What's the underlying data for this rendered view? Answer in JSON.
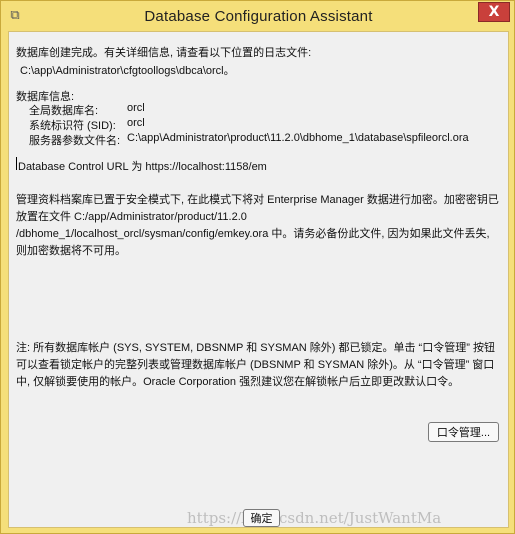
{
  "window": {
    "title": "Database Configuration Assistant",
    "close_label": "X"
  },
  "messages": {
    "created": "数据库创建完成。有关详细信息, 请查看以下位置的日志文件:",
    "log_path": "C:\\app\\Administrator\\cfgtoollogs\\dbca\\orcl。",
    "info_heading": "数据库信息:",
    "db_info": [
      {
        "label": "全局数据库名:",
        "value": "orcl"
      },
      {
        "label": "系统标识符 (SID):",
        "value": "orcl"
      },
      {
        "label": "服务器参数文件名:",
        "value": "C:\\app\\Administrator\\product\\11.2.0\\dbhome_1\\database\\spfileorcl.ora"
      }
    ],
    "db_control_url": "Database Control URL 为 https://localhost:1158/em",
    "security_note": "管理资料档案库已置于安全模式下, 在此模式下将对 Enterprise Manager 数据进行加密。加密密钥已放置在文件 C:/app/Administrator/product/11.2.0 /dbhome_1/localhost_orcl/sysman/config/emkey.ora 中。请务必备份此文件, 因为如果此文件丢失, 则加密数据将不可用。",
    "lock_note": "注: 所有数据库帐户 (SYS, SYSTEM, DBSNMP 和 SYSMAN 除外) 都已锁定。单击 “口令管理” 按钮可以查看锁定帐户的完整列表或管理数据库帐户 (DBSNMP 和 SYSMAN 除外)。从 “口令管理” 窗口中, 仅解锁要使用的帐户。Oracle Corporation 强烈建议您在解锁帐户后立即更改默认口令。"
  },
  "buttons": {
    "password_management": "口令管理...",
    "ok": "确定"
  },
  "watermark": "https://blog.csdn.net/JustWantMa",
  "colors": {
    "frame": "#f5df7a",
    "close": "#c9403b",
    "content_bg": "#f0f0f0"
  }
}
